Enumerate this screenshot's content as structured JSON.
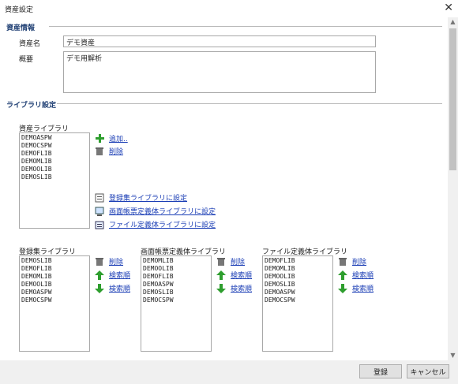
{
  "window": {
    "title": "資産設定",
    "close_glyph": "✕"
  },
  "asset_info": {
    "heading": "資産情報",
    "name_label": "資産名",
    "name_value": "デモ資産",
    "summary_label": "概要",
    "summary_value": "デモ用解析"
  },
  "library_settings": {
    "heading": "ライブラリ設定",
    "asset_library": {
      "label": "資産ライブラリ",
      "items": [
        "DEMOASPW",
        "DEMOCSPW",
        "DEMOFLIB",
        "DEMOMLIB",
        "DEMOOLIB",
        "DEMOSLIB"
      ],
      "add_label": "追加..",
      "delete_label": "削除",
      "set_search_label": "登録集ライブラリに設定",
      "set_screen_label": "画面帳票定義体ライブラリに設定",
      "set_file_label": "ファイル定義体ライブラリに設定"
    },
    "search_library": {
      "label": "登録集ライブラリ",
      "items": [
        "DEMOSLIB",
        "DEMOFLIB",
        "DEMOMLIB",
        "DEMOOLIB",
        "DEMOASPW",
        "DEMOCSPW"
      ],
      "delete_label": "削除",
      "up_label": "検索順",
      "down_label": "検索順"
    },
    "screen_library": {
      "label": "画面帳票定義体ライブラリ",
      "items": [
        "DEMOMLIB",
        "DEMOOLIB",
        "DEMOFLIB",
        "DEMOASPW",
        "DEMOSLIB",
        "DEMOCSPW"
      ],
      "delete_label": "削除",
      "up_label": "検索順",
      "down_label": "検索順"
    },
    "file_library": {
      "label": "ファイル定義体ライブラリ",
      "items": [
        "DEMOFLIB",
        "DEMOMLIB",
        "DEMOOLIB",
        "DEMOSLIB",
        "DEMOASPW",
        "DEMOCSPW"
      ],
      "delete_label": "削除",
      "up_label": "検索順",
      "down_label": "検索順"
    }
  },
  "footer": {
    "ok_label": "登録",
    "cancel_label": "キャンセル"
  },
  "colors": {
    "section_heading": "#1f3f73",
    "link": "#1a3db5",
    "add_green": "#2e9e2e",
    "arrow_green": "#2e9e2e"
  },
  "icons": [
    "close-icon",
    "plus-icon",
    "trash-icon",
    "search-lib-icon",
    "screen-lib-icon",
    "file-lib-icon",
    "arrow-up-icon",
    "arrow-down-icon"
  ]
}
